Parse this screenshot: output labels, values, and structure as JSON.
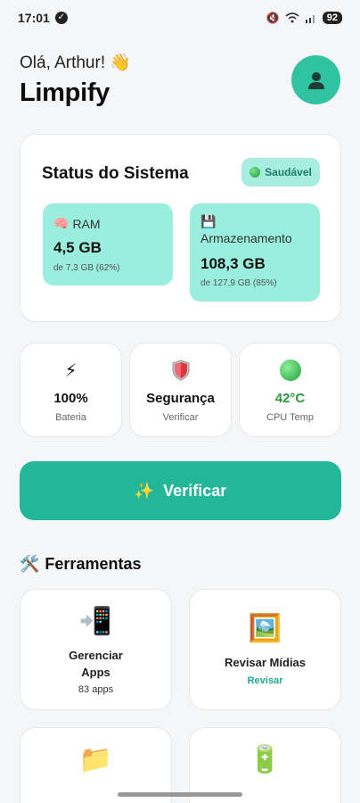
{
  "status_bar": {
    "time": "17:01",
    "battery": "92",
    "icons": [
      "check-circle-icon",
      "mute-icon",
      "wifi-icon",
      "signal-icon"
    ]
  },
  "header": {
    "greeting": "Olá, Arthur! 👋",
    "app_name": "Limpify",
    "avatar_icon": "user-icon"
  },
  "system_status": {
    "title": "Status do Sistema",
    "badge": "Saudável",
    "ram": {
      "label": "RAM",
      "icon": "🧠",
      "value": "4,5 GB",
      "detail": "de 7,3 GB (62%)"
    },
    "storage": {
      "label": "Armazenamento",
      "icon": "💾",
      "value": "108,3 GB",
      "detail": "de 127,9 GB (85%)"
    }
  },
  "quick_stats": [
    {
      "icon": "⚡",
      "value": "100%",
      "label": "Bateria"
    },
    {
      "icon": "shield-icon",
      "value": "Segurança",
      "label": "Verificar"
    },
    {
      "icon": "green-dot-icon",
      "value": "42°C",
      "label": "CPU Temp"
    }
  ],
  "verify_button": {
    "icon": "✨",
    "label": "Verificar"
  },
  "tools": {
    "title": "Ferramentas",
    "title_icon": "🛠️",
    "items": [
      {
        "icon": "📲",
        "name": "Gerenciar Apps",
        "sub": "83 apps"
      },
      {
        "icon": "🖼️",
        "name": "Revisar Mídias",
        "sub": "Revisar"
      },
      {
        "icon": "📁",
        "name": "",
        "sub": ""
      },
      {
        "icon": "🔋",
        "name": "",
        "sub": ""
      }
    ]
  },
  "colors": {
    "accent": "#23b79a",
    "mini_card": "#9aeedd",
    "badge_bg": "#a7eee0",
    "badge_text": "#1d7d67",
    "temp": "#2a9a3c"
  }
}
